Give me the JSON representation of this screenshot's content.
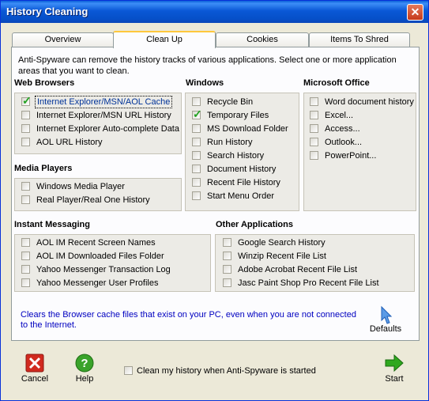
{
  "window": {
    "title": "History Cleaning",
    "close_icon": "close-icon"
  },
  "tabs": [
    {
      "label": "Overview",
      "active": false
    },
    {
      "label": "Clean Up",
      "active": true
    },
    {
      "label": "Cookies",
      "active": false
    },
    {
      "label": "Items To Shred",
      "active": false
    }
  ],
  "intro": "Anti-Spyware can remove the history tracks of various applications. Select one or more application areas that you want to clean.",
  "web_browsers": {
    "title": "Web Browsers",
    "items": [
      {
        "label": "Internet Explorer/MSN/AOL Cache",
        "checked": true
      },
      {
        "label": "Internet Explorer/MSN URL History",
        "checked": false
      },
      {
        "label": "Internet Explorer Auto-complete Data",
        "checked": false
      },
      {
        "label": "AOL URL History",
        "checked": false
      }
    ]
  },
  "windows": {
    "title": "Windows",
    "items": [
      {
        "label": "Recycle Bin",
        "checked": false
      },
      {
        "label": "Temporary Files",
        "checked": true
      },
      {
        "label": "MS Download Folder",
        "checked": false
      },
      {
        "label": "Run History",
        "checked": false
      },
      {
        "label": "Search History",
        "checked": false
      },
      {
        "label": "Document History",
        "checked": false
      },
      {
        "label": "Recent File History",
        "checked": false
      },
      {
        "label": "Start Menu Order",
        "checked": false
      }
    ]
  },
  "office": {
    "title": "Microsoft Office",
    "items": [
      {
        "label": "Word document history",
        "checked": false
      },
      {
        "label": "Excel...",
        "checked": false
      },
      {
        "label": "Access...",
        "checked": false
      },
      {
        "label": "Outlook...",
        "checked": false
      },
      {
        "label": "PowerPoint...",
        "checked": false
      }
    ]
  },
  "media_players": {
    "title": "Media Players",
    "items": [
      {
        "label": "Windows Media Player",
        "checked": false
      },
      {
        "label": "Real Player/Real One History",
        "checked": false
      }
    ]
  },
  "instant_messaging": {
    "title": "Instant Messaging",
    "items": [
      {
        "label": "AOL IM Recent Screen Names",
        "checked": false
      },
      {
        "label": "AOL IM Downloaded Files Folder",
        "checked": false
      },
      {
        "label": "Yahoo Messenger Transaction Log",
        "checked": false
      },
      {
        "label": "Yahoo Messenger User Profiles",
        "checked": false
      }
    ]
  },
  "other_apps": {
    "title": "Other Applications",
    "items": [
      {
        "label": "Google Search History",
        "checked": false
      },
      {
        "label": "Winzip Recent File List",
        "checked": false
      },
      {
        "label": "Adobe Acrobat Recent File List",
        "checked": false
      },
      {
        "label": "Jasc Paint Shop Pro Recent File List",
        "checked": false
      }
    ]
  },
  "info": "Clears the Browser cache files that exist on your PC, even when you are not connected to the Internet.",
  "defaults_label": "Defaults",
  "footer": {
    "cancel_label": "Cancel",
    "help_label": "Help",
    "auto_clean_label": "Clean my history when Anti-Spyware is started",
    "auto_clean_checked": false,
    "start_label": "Start"
  },
  "colors": {
    "title_bar": "#0a58d6",
    "info_text": "#0000c0",
    "cancel_red": "#d12a1f",
    "help_green": "#3aa32a",
    "start_green": "#2fa81f"
  }
}
